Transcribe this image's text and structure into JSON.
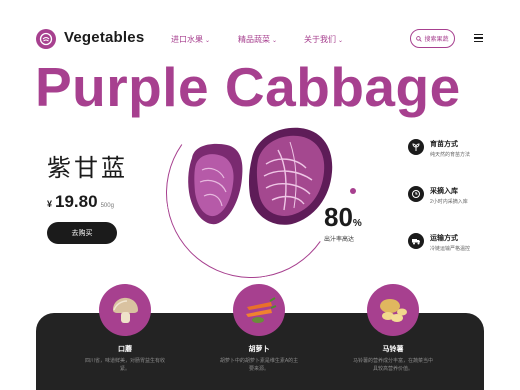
{
  "header": {
    "logo_text": "Vegetables",
    "logo_icon": "cabbage-icon",
    "nav": [
      {
        "label": "进口水果"
      },
      {
        "label": "精品蔬菜"
      },
      {
        "label": "关于我们"
      }
    ],
    "search_label": "搜索果蔬",
    "menu_icon": "hamburger-menu-icon"
  },
  "hero": {
    "title": "Purple Cabbage",
    "name_cn": "紫甘蓝",
    "currency": "¥",
    "price": "19.80",
    "unit": "500g",
    "buy_label": "去购买",
    "stat_value": "80",
    "stat_unit": "%",
    "stat_caption": "出汁率高达"
  },
  "features": [
    {
      "title": "育苗方式",
      "desc": "纯天然的育苗方法",
      "icon": "sprout-icon"
    },
    {
      "title": "采摘入库",
      "desc": "2小时内采摘入库",
      "icon": "clock-icon"
    },
    {
      "title": "运输方式",
      "desc": "冷链运输严格温控",
      "icon": "truck-icon"
    }
  ],
  "vegetables": [
    {
      "name": "口蘑",
      "desc": "四川省，味道鲜美，对肠胃益生有收紧。",
      "icon": "mushroom-icon"
    },
    {
      "name": "胡萝卜",
      "desc": "胡萝卜中的胡萝卜素是维生素A的主要来源。",
      "icon": "carrot-icon"
    },
    {
      "name": "马铃薯",
      "desc": "马铃薯的营养成分丰富，在蔬菜当中具较高营养价值。",
      "icon": "potato-icon"
    }
  ],
  "colors": {
    "accent": "#a7408f",
    "dark": "#232323",
    "text": "#1b1b1b"
  }
}
